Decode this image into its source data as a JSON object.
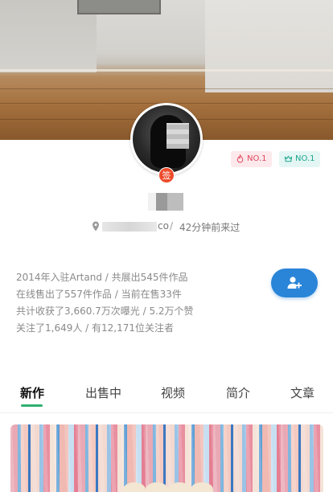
{
  "profile": {
    "signed_badge": "签",
    "rank_badges": [
      {
        "label": "NO.1",
        "icon": "flame-icon",
        "color": "#e0465b"
      },
      {
        "label": "NO.1",
        "icon": "crown-icon",
        "color": "#1aa58f"
      }
    ],
    "location_suffix": "co",
    "separator": "/",
    "last_seen": "42分钟前来过"
  },
  "stats": {
    "line1": "2014年入驻Artand / 共展出545件作品",
    "line2": "在线售出了557件作品 / 当前在售33件",
    "line3": "共计收获了3,660.7万次曝光 / 5.2万个赞",
    "line4": "关注了1,649人 / 有12,171位关注者"
  },
  "follow_button": {
    "icon": "add-user-icon",
    "color": "#2a85d8"
  },
  "tabs": [
    {
      "label": "新作",
      "active": true
    },
    {
      "label": "出售中",
      "active": false
    },
    {
      "label": "视频",
      "active": false
    },
    {
      "label": "简介",
      "active": false
    },
    {
      "label": "文章",
      "active": false
    }
  ],
  "colors": {
    "accent_green": "#2fb070",
    "sign_red": "#ee4b2b"
  }
}
